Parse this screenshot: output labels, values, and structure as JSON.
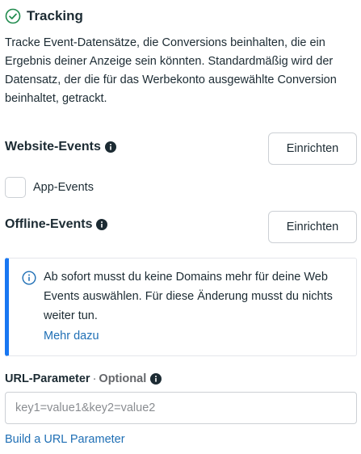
{
  "tracking": {
    "title": "Tracking",
    "description": "Tracke Event-Datensätze, die Conversions beinhalten, die ein Ergebnis deiner Anzeige sein könnten. Standardmäßig wird der Datensatz, der die für das Werbekonto ausgewählte Conversion beinhaltet, getrackt."
  },
  "website_events": {
    "label": "Website-Events",
    "button": "Einrichten"
  },
  "app_events": {
    "label": "App-Events",
    "checked": false
  },
  "offline_events": {
    "label": "Offline-Events",
    "button": "Einrichten"
  },
  "notice": {
    "text": "Ab sofort musst du keine Domains mehr für deine Web Events auswählen. Für diese Änderung musst du nichts weiter tun.",
    "link": "Mehr dazu",
    "accent_color": "#1877f2"
  },
  "url_parameter": {
    "label": "URL-Parameter",
    "separator": "·",
    "optional": "Optional",
    "placeholder": "key1=value1&key2=value2",
    "value": "",
    "build_link": "Build a URL Parameter"
  },
  "colors": {
    "success": "#1e8a4c",
    "link": "#1f6fb5",
    "text": "#1c2b33"
  }
}
